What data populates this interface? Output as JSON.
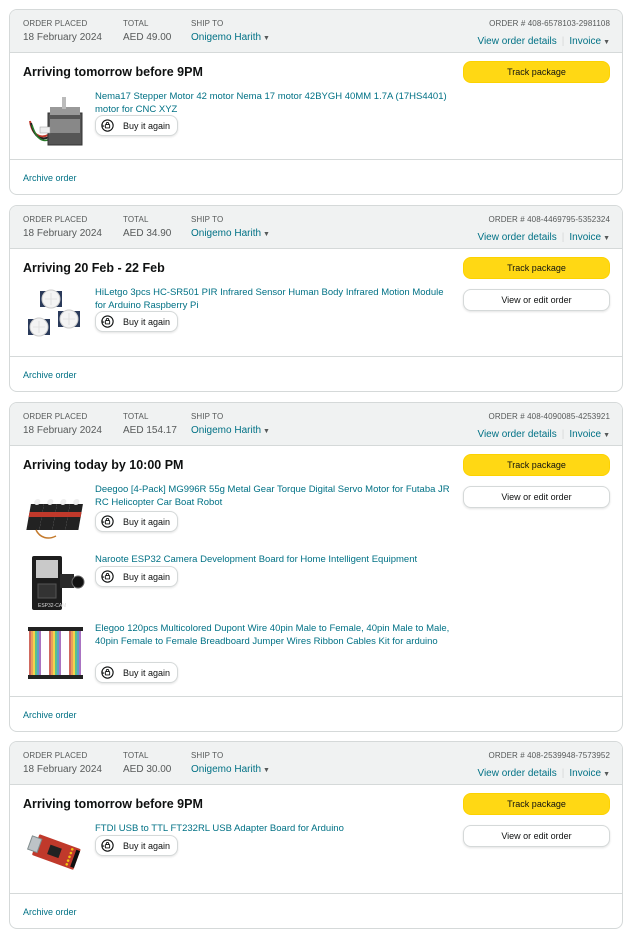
{
  "labels": {
    "order_placed": "ORDER PLACED",
    "total": "TOTAL",
    "ship_to": "SHIP TO",
    "view_order_details": "View order details",
    "invoice": "Invoice",
    "track_package": "Track package",
    "view_or_edit_order": "View or edit order",
    "buy_it_again": "Buy it again",
    "archive_order": "Archive order"
  },
  "orders": [
    {
      "date": "18 February 2024",
      "total": "AED 49.00",
      "ship_to": "Onigemo Harith",
      "order_number": "ORDER # 408-6578103-2981108",
      "status": "Arriving tomorrow before 9PM",
      "items": [
        {
          "title": "Nema17 Stepper Motor 42 motor Nema 17 motor 42BYGH 40MM 1.7A (17HS4401) motor for CNC XYZ",
          "image": "stepper-motor-icon"
        }
      ]
    },
    {
      "date": "18 February 2024",
      "total": "AED 34.90",
      "ship_to": "Onigemo Harith",
      "order_number": "ORDER # 408-4469795-5352324",
      "status": "Arriving 20 Feb - 22 Feb",
      "items": [
        {
          "title": "HiLetgo 3pcs HC-SR501 PIR Infrared Sensor Human Body Infrared Motion Module for Arduino Raspberry Pi",
          "image": "pir-sensor-icon"
        }
      ]
    },
    {
      "date": "18 February 2024",
      "total": "AED 154.17",
      "ship_to": "Onigemo Harith",
      "order_number": "ORDER # 408-4090085-4253921",
      "status": "Arriving today by 10:00 PM",
      "items": [
        {
          "title": "Deegoo [4-Pack] MG996R 55g Metal Gear Torque Digital Servo Motor for Futaba JR RC Helicopter Car Boat Robot",
          "image": "servo-motor-icon"
        },
        {
          "title": "Naroote ESP32 Camera Development Board for Home Intelligent Equipment",
          "image": "esp32-camera-icon"
        },
        {
          "title": "Elegoo 120pcs Multicolored Dupont Wire 40pin Male to Female, 40pin Male to Male, 40pin Female to Female Breadboard Jumper Wires Ribbon Cables Kit for arduino",
          "image": "jumper-wires-icon"
        }
      ]
    },
    {
      "date": "18 February 2024",
      "total": "AED 30.00",
      "ship_to": "Onigemo Harith",
      "order_number": "ORDER # 408-2539948-7573952",
      "status": "Arriving tomorrow before 9PM",
      "items": [
        {
          "title": "FTDI USB to TTL FT232RL USB Adapter Board for Arduino",
          "image": "usb-ttl-board-icon"
        }
      ]
    }
  ]
}
